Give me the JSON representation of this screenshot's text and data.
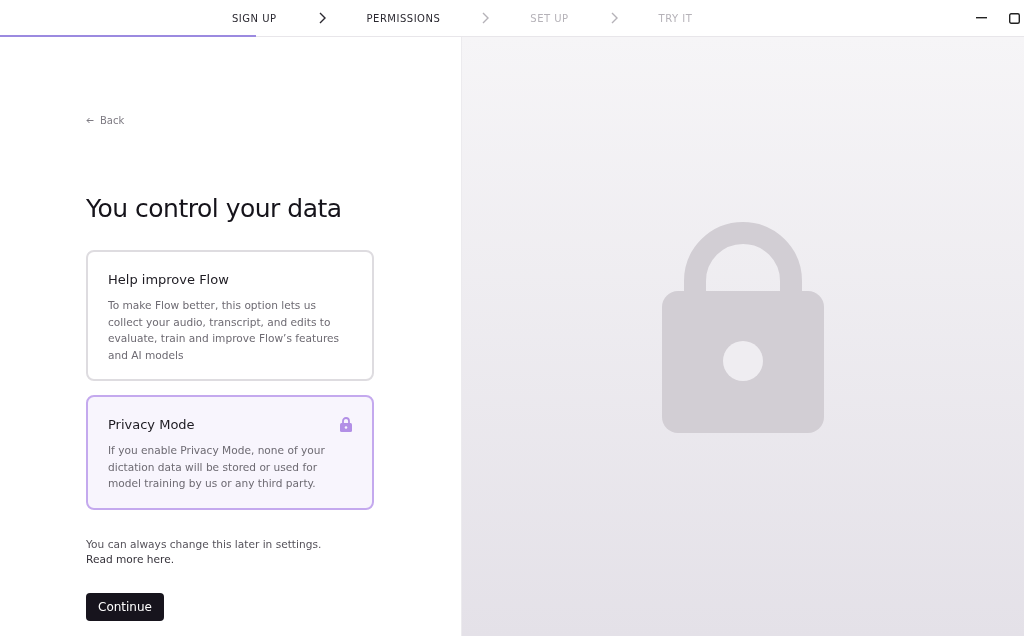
{
  "steps": [
    {
      "label": "SIGN UP",
      "disabled": false
    },
    {
      "label": "PERMISSIONS",
      "disabled": false
    },
    {
      "label": "SET UP",
      "disabled": true
    },
    {
      "label": "TRY IT",
      "disabled": true
    }
  ],
  "progress": {
    "level": 0.25
  },
  "back": {
    "label": "Back"
  },
  "title": "You control your data",
  "options": [
    {
      "kind": "plain",
      "title": "Help improve Flow",
      "description": "To make Flow better, this option lets us collect your audio, transcript, and edits to evaluate, train and improve Flow’s features and AI models",
      "selected": false
    },
    {
      "kind": "private",
      "title": "Privacy Mode",
      "description": "If you enable Privacy Mode, none of your dictation data will be stored or used for model training by us or any third party.",
      "selected": true
    }
  ],
  "note": "You can always change this later in settings.",
  "link": "Read more here.",
  "continue_button": "Continue"
}
